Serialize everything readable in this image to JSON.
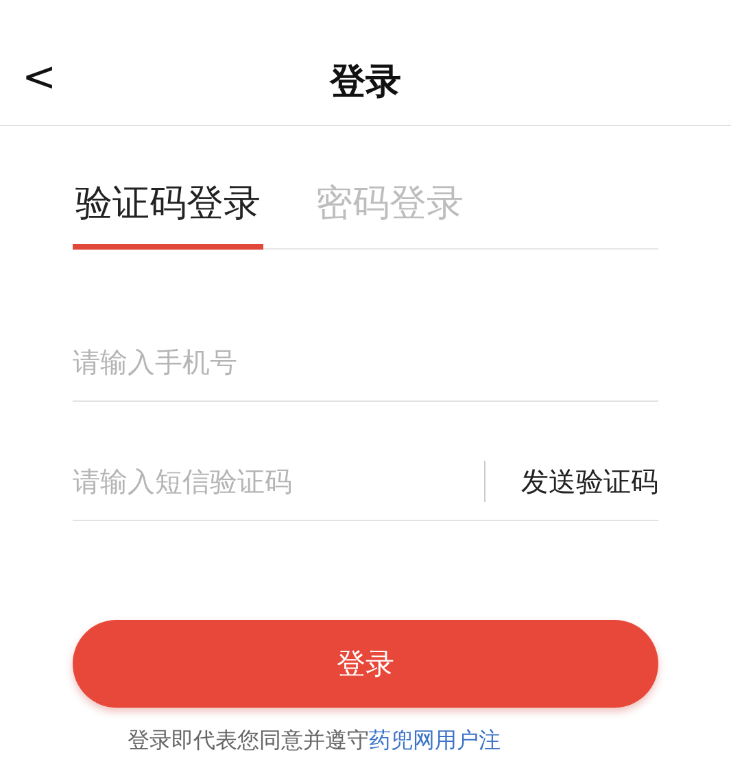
{
  "header": {
    "back": "<",
    "title": "登录"
  },
  "tabs": [
    {
      "label": "验证码登录",
      "selected": true
    },
    {
      "label": "密码登录",
      "selected": false
    }
  ],
  "phone_field": {
    "placeholder": "请输入手机号"
  },
  "code_field": {
    "placeholder": "请输入短信验证码",
    "send_button": "发送验证码"
  },
  "login_button": "登录",
  "agreement": {
    "text": "登录即代表您同意并遵守",
    "link": "药兜网用户注"
  }
}
